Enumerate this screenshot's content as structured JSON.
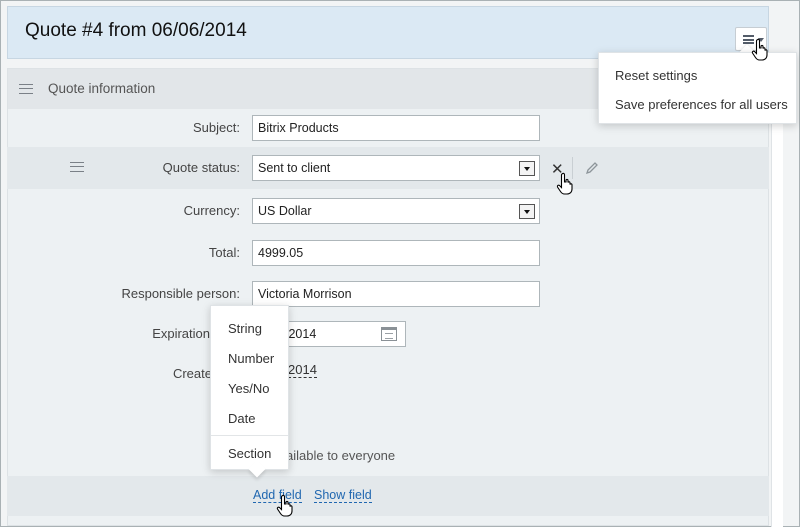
{
  "header": {
    "title": "Quote #4 from 06/06/2014"
  },
  "settings_menu": {
    "items": [
      "Reset settings",
      "Save preferences for all users"
    ]
  },
  "section": {
    "title": "Quote information"
  },
  "fields": {
    "subject": {
      "label": "Subject:",
      "value": "Bitrix Products"
    },
    "quote_status": {
      "label": "Quote status:",
      "value": "Sent to client"
    },
    "currency": {
      "label": "Currency:",
      "value": "US Dollar"
    },
    "total": {
      "label": "Total:",
      "value": "4999.05"
    },
    "responsible": {
      "label": "Responsible person:",
      "value": "Victoria Morrison"
    },
    "expiration": {
      "label": "Expiration",
      "value_visible": "/2014"
    },
    "created": {
      "label": "Create",
      "value_visible": "2014"
    },
    "availability_visible": "ailable to everyone"
  },
  "field_type_menu": {
    "items": [
      "String",
      "Number",
      "Yes/No",
      "Date"
    ],
    "section_item": "Section"
  },
  "footer_links": {
    "add_field": "Add field",
    "show_field": "Show field"
  }
}
